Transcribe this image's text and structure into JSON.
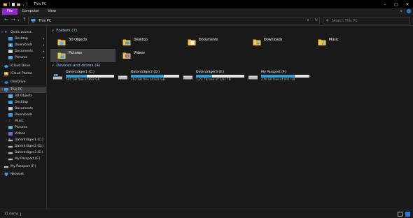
{
  "window": {
    "title": "This PC",
    "controls": [
      "–",
      "▢",
      "✕"
    ]
  },
  "ribbon": {
    "tabs": [
      "File",
      "Computer",
      "View"
    ]
  },
  "address": {
    "path": "This PC",
    "search_placeholder": "Search This PC"
  },
  "sidebar": {
    "items": [
      {
        "label": "Quick access",
        "icon": "star-icon",
        "level": 0,
        "expanded": true
      },
      {
        "label": "Desktop",
        "icon": "desktop-folder-icon",
        "level": 1,
        "pinned": true
      },
      {
        "label": "Downloads",
        "icon": "downloads-folder-icon",
        "level": 1,
        "pinned": true
      },
      {
        "label": "Documents",
        "icon": "documents-folder-icon",
        "level": 1,
        "pinned": true
      },
      {
        "label": "Pictures",
        "icon": "pictures-folder-icon",
        "level": 1,
        "pinned": true
      },
      {
        "label": "iCloud Drive",
        "icon": "cloud-drive-icon",
        "level": 0
      },
      {
        "label": "iCloud Photos",
        "icon": "cloud-photos-icon",
        "level": 0
      },
      {
        "label": "OneDrive",
        "icon": "onedrive-icon",
        "level": 0
      },
      {
        "label": "This PC",
        "icon": "pc-icon",
        "level": 0,
        "expanded": true,
        "selected": true
      },
      {
        "label": "3D Objects",
        "icon": "3d-objects-icon",
        "level": 1
      },
      {
        "label": "Desktop",
        "icon": "desktop-folder-icon",
        "level": 1
      },
      {
        "label": "Documents",
        "icon": "documents-folder-icon",
        "level": 1
      },
      {
        "label": "Downloads",
        "icon": "downloads-folder-icon",
        "level": 1
      },
      {
        "label": "Music",
        "icon": "music-folder-icon",
        "level": 1
      },
      {
        "label": "Pictures",
        "icon": "pictures-folder-icon",
        "level": 1
      },
      {
        "label": "Videos",
        "icon": "videos-folder-icon",
        "level": 1
      },
      {
        "label": "Datenträger1 (C:)",
        "icon": "system-drive-icon",
        "level": 1
      },
      {
        "label": "Datenträger2 (D:)",
        "icon": "drive-icon",
        "level": 1
      },
      {
        "label": "Datenträger3 (E:)",
        "icon": "drive-icon",
        "level": 1
      },
      {
        "label": "My Passport (F:)",
        "icon": "drive-icon",
        "level": 1
      },
      {
        "label": "My Passport (F:)",
        "icon": "drive-icon",
        "level": 0
      },
      {
        "label": "Network",
        "icon": "network-icon",
        "level": 0
      }
    ]
  },
  "main": {
    "folders_title": "Folders (7)",
    "drives_title": "Devices and drives (4)",
    "folders": [
      {
        "label": "3D Objects",
        "icon": "3d-objects-icon"
      },
      {
        "label": "Desktop",
        "icon": "desktop-folder-icon"
      },
      {
        "label": "Documents",
        "icon": "documents-folder-icon"
      },
      {
        "label": "Downloads",
        "icon": "downloads-folder-icon"
      },
      {
        "label": "Music",
        "icon": "music-folder-icon"
      },
      {
        "label": "Pictures",
        "icon": "pictures-folder-icon",
        "selected": true
      },
      {
        "label": "Videos",
        "icon": "videos-folder-icon"
      }
    ],
    "drives": [
      {
        "name": "Datenträger1 (C:)",
        "free": "501 GB free of 893 GB",
        "used_fraction": 0.44,
        "icon": "system-drive-icon"
      },
      {
        "name": "Datenträger2 (D:)",
        "free": "297 GB free of 931 GB",
        "used_fraction": 0.68,
        "icon": "drive-icon"
      },
      {
        "name": "Datenträger3 (E:)",
        "free": "1,22 TB free of 1,81 TB",
        "used_fraction": 0.33,
        "icon": "drive-icon"
      },
      {
        "name": "My Passport (F:)",
        "free": "276 GB free of 931 GB",
        "used_fraction": 0.7,
        "icon": "drive-icon"
      }
    ]
  },
  "status": {
    "item_count": "11 items"
  },
  "colors": {
    "accent": "#26a0da",
    "file_tab": "#8f2ad0",
    "folder_yellow": "#f3c543"
  }
}
